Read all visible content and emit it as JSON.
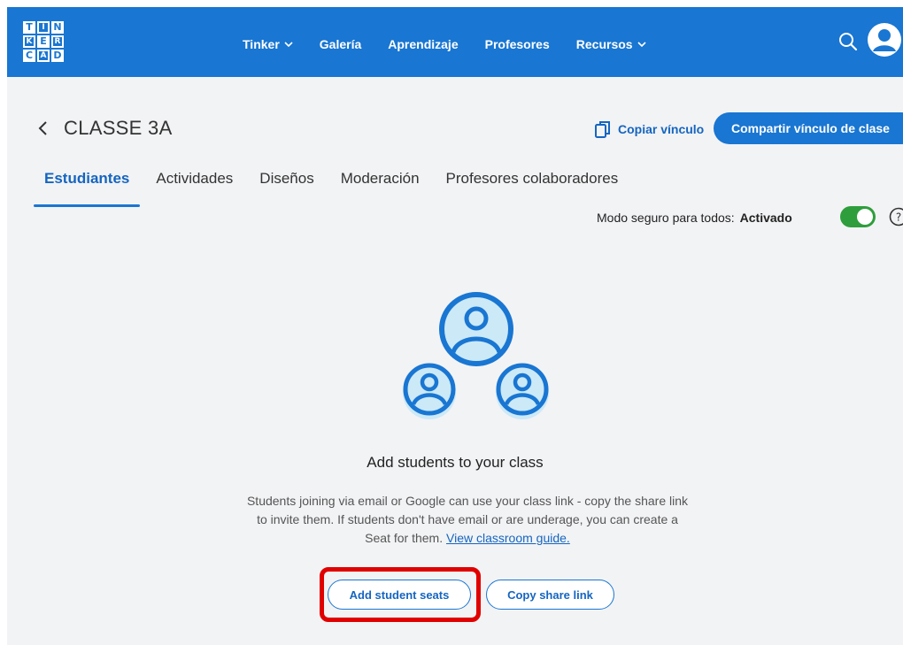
{
  "nav": {
    "logo": [
      "T",
      "I",
      "N",
      "K",
      "E",
      "R",
      "C",
      "A",
      "D"
    ],
    "items": [
      {
        "label": "Tinker",
        "has_dropdown": true
      },
      {
        "label": "Galería",
        "has_dropdown": false
      },
      {
        "label": "Aprendizaje",
        "has_dropdown": false
      },
      {
        "label": "Profesores",
        "has_dropdown": false
      },
      {
        "label": "Recursos",
        "has_dropdown": true
      }
    ]
  },
  "header": {
    "class_name": "CLASSE 3A",
    "copy_link_label": "Copiar vínculo",
    "share_class_label": "Compartir vínculo de clase"
  },
  "tabs": [
    {
      "label": "Estudiantes",
      "active": true
    },
    {
      "label": "Actividades",
      "active": false
    },
    {
      "label": "Diseños",
      "active": false
    },
    {
      "label": "Moderación",
      "active": false
    },
    {
      "label": "Profesores colaboradores",
      "active": false
    }
  ],
  "safe_mode": {
    "label": "Modo seguro para todos:",
    "state": "Activado",
    "enabled": true
  },
  "empty_state": {
    "title": "Add students to your class",
    "description": "Students joining via email or Google can use your class link - copy the share link to invite them. If students don't have email or are underage, you can create a Seat for them.",
    "guide_link": "View classroom guide.",
    "add_seats_label": "Add student seats",
    "copy_share_label": "Copy share link"
  },
  "colors": {
    "brand_blue": "#1976d2",
    "toggle_green": "#2e9e3c",
    "highlight_red": "#e00000",
    "illustration_fill": "#cce9f7"
  }
}
